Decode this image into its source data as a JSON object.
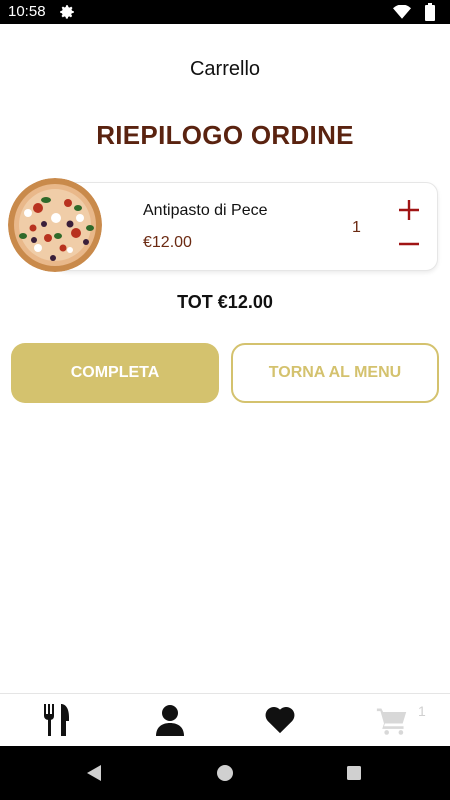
{
  "status_bar": {
    "time": "10:58"
  },
  "header": {
    "title": "Carrello"
  },
  "summary": {
    "title": "RIEPILOGO ORDINE"
  },
  "cart": {
    "items": [
      {
        "name": "Antipasto di Pece",
        "price": "€12.00",
        "quantity": "1"
      }
    ],
    "total": "TOT €12.00"
  },
  "actions": {
    "complete_label": "COMPLETA",
    "back_to_menu_label": "TORNA AL MENU"
  },
  "tab_bar": {
    "cart_badge": "1",
    "icons": [
      "cutlery-icon",
      "user-icon",
      "heart-icon",
      "cart-icon"
    ]
  },
  "colors": {
    "accent": "#d4c26e",
    "title_brown": "#5a2310",
    "price_brown": "#6b2a12",
    "stepper_red": "#a01414"
  }
}
